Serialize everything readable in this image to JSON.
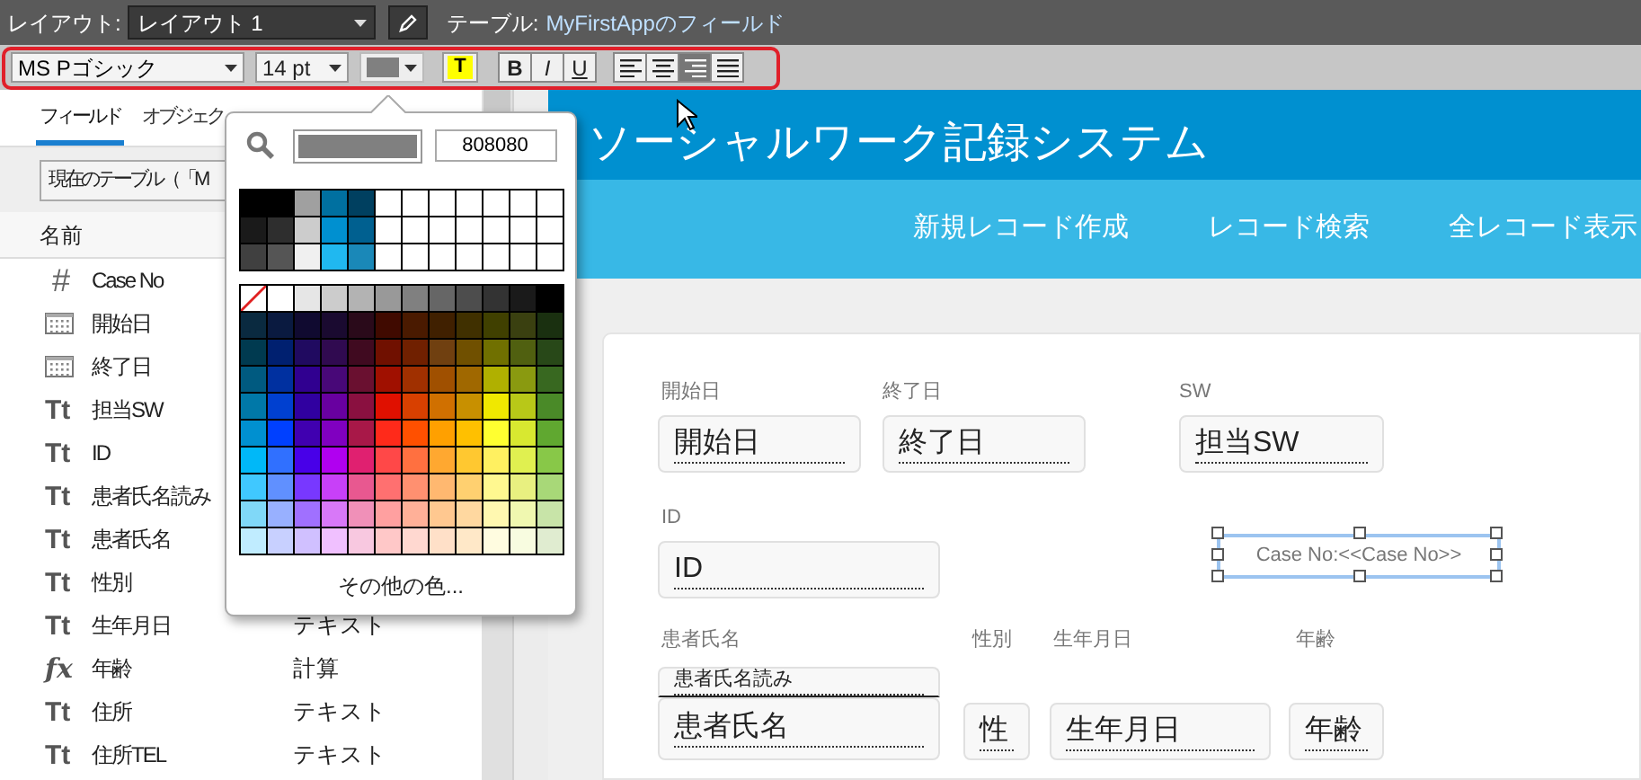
{
  "top_bar": {
    "layout_label": "レイアウト:",
    "layout_value": "レイアウト 1",
    "table_label": "テーブル:",
    "table_name": "MyFirstAppのフィールド"
  },
  "format_bar": {
    "font": "MS Pゴシック",
    "size": "14 pt",
    "highlight_label": "T",
    "styles": [
      {
        "label": "B",
        "on": false
      },
      {
        "label": "I",
        "on": false
      },
      {
        "label": "U",
        "on": false
      }
    ],
    "alignments": [
      {
        "kind": "left",
        "selected": false
      },
      {
        "kind": "center",
        "selected": false
      },
      {
        "kind": "right",
        "selected": true
      },
      {
        "kind": "justify",
        "selected": false
      }
    ]
  },
  "field_panel": {
    "tabs": [
      {
        "label": "フィールド",
        "selected": true
      },
      {
        "label": "オブジェク",
        "selected": false
      }
    ],
    "table_select": "現在のテーブル（「M",
    "column_header": "名前",
    "fields": [
      {
        "kind": "number",
        "icon": "#",
        "name": "Case No"
      },
      {
        "kind": "date",
        "name": "開始日"
      },
      {
        "kind": "date",
        "name": "終了日"
      },
      {
        "kind": "text",
        "icon": "Tt",
        "name": "担当SW"
      },
      {
        "kind": "text",
        "icon": "Tt",
        "name": "ID"
      },
      {
        "kind": "text",
        "icon": "Tt",
        "name": "患者氏名読み"
      },
      {
        "kind": "text",
        "icon": "Tt",
        "name": "患者氏名"
      },
      {
        "kind": "text",
        "icon": "Tt",
        "name": "性別"
      },
      {
        "kind": "text",
        "icon": "Tt",
        "name": "生年月日",
        "type": "テキスト"
      },
      {
        "kind": "calc",
        "icon": "fx",
        "name": "年齢",
        "type": "計算"
      },
      {
        "kind": "text",
        "icon": "Tt",
        "name": "住所",
        "type": "テキスト"
      },
      {
        "kind": "text",
        "icon": "Tt",
        "name": "住所TEL",
        "type": "テキスト"
      }
    ]
  },
  "color_picker": {
    "hex": "808080",
    "more_label": "その他の色...",
    "recent_rows": [
      [
        {
          "color": "#000000"
        },
        {
          "color": "#000000"
        },
        {
          "color": "#a0a0a0"
        },
        {
          "color": "#0070a0"
        },
        {
          "color": "#004060"
        },
        {
          "color": "#ffffff"
        },
        {
          "color": "#ffffff"
        },
        {
          "color": "#ffffff"
        },
        {
          "color": "#ffffff"
        },
        {
          "color": "#ffffff"
        },
        {
          "color": "#ffffff"
        },
        {
          "color": "#ffffff"
        }
      ],
      [
        {
          "color": "#1a1a1a"
        },
        {
          "color": "#2e2e2e"
        },
        {
          "color": "#cccccc"
        },
        {
          "color": "#0090d0"
        },
        {
          "color": "#006090"
        },
        {
          "color": "#ffffff"
        },
        {
          "color": "#ffffff"
        },
        {
          "color": "#ffffff"
        },
        {
          "color": "#ffffff"
        },
        {
          "color": "#ffffff"
        },
        {
          "color": "#ffffff"
        },
        {
          "color": "#ffffff"
        }
      ],
      [
        {
          "color": "#404040"
        },
        {
          "color": "#555555"
        },
        {
          "color": "#f0f0f0"
        },
        {
          "color": "#20b8f0"
        },
        {
          "color": "#1a88b8"
        },
        {
          "color": "#ffffff"
        },
        {
          "color": "#ffffff"
        },
        {
          "color": "#ffffff"
        },
        {
          "color": "#ffffff"
        },
        {
          "color": "#ffffff"
        },
        {
          "color": "#ffffff"
        },
        {
          "color": "#ffffff"
        }
      ]
    ],
    "gray_row": [
      {
        "kind": "none"
      },
      {
        "kind": "swatch",
        "color": "#ffffff"
      },
      {
        "kind": "swatch",
        "color": "#e6e6e6"
      },
      {
        "kind": "swatch",
        "color": "#cccccc"
      },
      {
        "kind": "swatch",
        "color": "#b3b3b3"
      },
      {
        "kind": "swatch",
        "color": "#999999"
      },
      {
        "kind": "swatch",
        "color": "#808080"
      },
      {
        "kind": "swatch",
        "color": "#666666"
      },
      {
        "kind": "swatch",
        "color": "#4d4d4d"
      },
      {
        "kind": "swatch",
        "color": "#333333"
      },
      {
        "kind": "swatch",
        "color": "#1a1a1a"
      },
      {
        "kind": "swatch",
        "color": "#000000"
      }
    ],
    "color_rows": [
      [
        {
          "color": "#0a2a40"
        },
        {
          "color": "#0a1a40"
        },
        {
          "color": "#100a30"
        },
        {
          "color": "#1a0a30"
        },
        {
          "color": "#2a0a1a"
        },
        {
          "color": "#400a00"
        },
        {
          "color": "#4a1a00"
        },
        {
          "color": "#402000"
        },
        {
          "color": "#403000"
        },
        {
          "color": "#404000"
        },
        {
          "color": "#3a4010"
        },
        {
          "color": "#1a3010"
        }
      ],
      [
        {
          "color": "#003a50"
        },
        {
          "color": "#002070"
        },
        {
          "color": "#200a60"
        },
        {
          "color": "#300a50"
        },
        {
          "color": "#400a20"
        },
        {
          "color": "#701000"
        },
        {
          "color": "#702000"
        },
        {
          "color": "#704010"
        },
        {
          "color": "#705000"
        },
        {
          "color": "#707000"
        },
        {
          "color": "#506010"
        },
        {
          "color": "#284818"
        }
      ],
      [
        {
          "color": "#005a80"
        },
        {
          "color": "#0030a0"
        },
        {
          "color": "#300090"
        },
        {
          "color": "#480878"
        },
        {
          "color": "#6a1030"
        },
        {
          "color": "#a01000"
        },
        {
          "color": "#a03000"
        },
        {
          "color": "#a05000"
        },
        {
          "color": "#a06800"
        },
        {
          "color": "#b0b000"
        },
        {
          "color": "#8a9a10"
        },
        {
          "color": "#386820"
        }
      ],
      [
        {
          "color": "#0078a8"
        },
        {
          "color": "#0040d0"
        },
        {
          "color": "#3000a0"
        },
        {
          "color": "#6800a0"
        },
        {
          "color": "#8a1040"
        },
        {
          "color": "#e01000"
        },
        {
          "color": "#d84000"
        },
        {
          "color": "#d07000"
        },
        {
          "color": "#c89000"
        },
        {
          "color": "#f0e800"
        },
        {
          "color": "#b8c818"
        },
        {
          "color": "#4a8a28"
        }
      ],
      [
        {
          "color": "#0090d0"
        },
        {
          "color": "#0040ff"
        },
        {
          "color": "#4000b0"
        },
        {
          "color": "#8000c0"
        },
        {
          "color": "#a81848"
        },
        {
          "color": "#ff2a1a"
        },
        {
          "color": "#ff5000"
        },
        {
          "color": "#ffa000"
        },
        {
          "color": "#ffc000"
        },
        {
          "color": "#ffff30"
        },
        {
          "color": "#d8e830"
        },
        {
          "color": "#60a830"
        }
      ],
      [
        {
          "color": "#00b8f8"
        },
        {
          "color": "#3070ff"
        },
        {
          "color": "#4800e8"
        },
        {
          "color": "#b000f0"
        },
        {
          "color": "#e02070"
        },
        {
          "color": "#ff4848"
        },
        {
          "color": "#ff7040"
        },
        {
          "color": "#ffa830"
        },
        {
          "color": "#ffc830"
        },
        {
          "color": "#fff060"
        },
        {
          "color": "#e0f050"
        },
        {
          "color": "#88c848"
        }
      ],
      [
        {
          "color": "#40c8ff"
        },
        {
          "color": "#6090ff"
        },
        {
          "color": "#7838ff"
        },
        {
          "color": "#c840f8"
        },
        {
          "color": "#e85890"
        },
        {
          "color": "#ff7070"
        },
        {
          "color": "#ff9070"
        },
        {
          "color": "#ffb870"
        },
        {
          "color": "#ffd070"
        },
        {
          "color": "#fff890"
        },
        {
          "color": "#e8f080"
        },
        {
          "color": "#a8d878"
        }
      ],
      [
        {
          "color": "#80d8f8"
        },
        {
          "color": "#98b0ff"
        },
        {
          "color": "#a070ff"
        },
        {
          "color": "#d878f8"
        },
        {
          "color": "#f090b8"
        },
        {
          "color": "#ffa0a0"
        },
        {
          "color": "#ffb098"
        },
        {
          "color": "#ffc890"
        },
        {
          "color": "#ffd8a0"
        },
        {
          "color": "#fff8b0"
        },
        {
          "color": "#f0f8b0"
        },
        {
          "color": "#c8e4a8"
        }
      ],
      [
        {
          "color": "#c0ecff"
        },
        {
          "color": "#c8d0ff"
        },
        {
          "color": "#d0c0ff"
        },
        {
          "color": "#f0c0ff"
        },
        {
          "color": "#f8c8e0"
        },
        {
          "color": "#ffc8c8"
        },
        {
          "color": "#ffd8d0"
        },
        {
          "color": "#ffe0c8"
        },
        {
          "color": "#ffe8c8"
        },
        {
          "color": "#fffce0"
        },
        {
          "color": "#f8fce0"
        },
        {
          "color": "#e0ecd0"
        }
      ]
    ]
  },
  "layout_canvas": {
    "title": "ソーシャルワーク記録システム",
    "nav": [
      "新規レコード作成",
      "レコード検索",
      "全レコード表示"
    ],
    "labels": [
      "開始日",
      "終了日",
      "SW",
      "ID",
      "患者氏名",
      "性別",
      "生年月日",
      "年齢"
    ],
    "fields": [
      "開始日",
      "終了日",
      "担当SW",
      "ID",
      "患者氏名読み",
      "患者氏名",
      "性",
      "生年月日",
      "年齢"
    ],
    "text_object": "Case No:<<Case No>>"
  }
}
